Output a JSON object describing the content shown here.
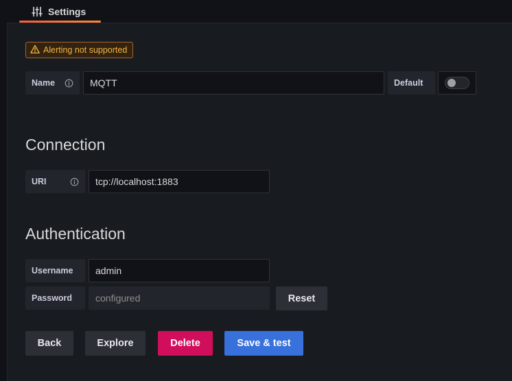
{
  "tabs": {
    "settings_label": "Settings",
    "settings_icon": "sliders-icon"
  },
  "alert": {
    "text": "Alerting not supported",
    "icon": "warning-triangle-icon",
    "color": "#f5b73d"
  },
  "general": {
    "name_label": "Name",
    "name_value": "MQTT",
    "default_label": "Default",
    "default_enabled": false
  },
  "connection": {
    "title": "Connection",
    "uri_label": "URI",
    "uri_value": "tcp://localhost:1883"
  },
  "authentication": {
    "title": "Authentication",
    "username_label": "Username",
    "username_value": "admin",
    "password_label": "Password",
    "password_placeholder": "configured",
    "reset_label": "Reset"
  },
  "actions": {
    "back_label": "Back",
    "explore_label": "Explore",
    "delete_label": "Delete",
    "save_label": "Save & test"
  },
  "colors": {
    "accent_underline": "#f55f3e",
    "danger": "#d10e5c",
    "primary": "#3871dc"
  }
}
